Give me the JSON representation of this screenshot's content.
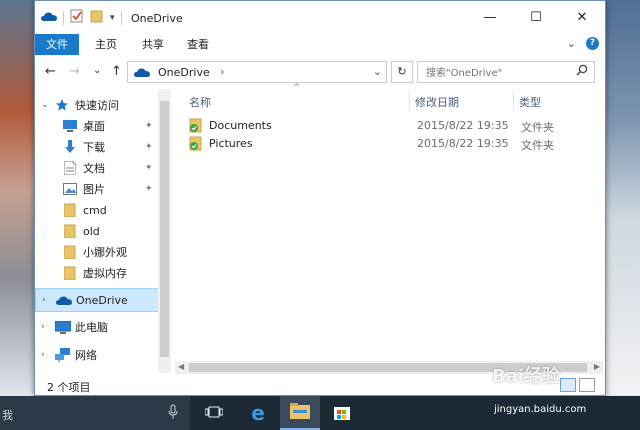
{
  "window": {
    "title": "OneDrive",
    "min_glyph": "—",
    "max_glyph": "☐",
    "close_glyph": "✕"
  },
  "ribbon": {
    "tabs": [
      {
        "label": "文件",
        "active": true
      },
      {
        "label": "主页",
        "active": false
      },
      {
        "label": "共享",
        "active": false
      },
      {
        "label": "查看",
        "active": false
      }
    ],
    "expand_glyph": "⌄",
    "help_glyph": "?"
  },
  "address": {
    "back_glyph": "←",
    "forward_glyph": "→",
    "recent_glyph": "⌄",
    "up_glyph": "↑",
    "path_label": "OneDrive",
    "sep_glyph": "›",
    "dropdown_glyph": "⌄",
    "refresh_glyph": "↻"
  },
  "search": {
    "placeholder": "搜索\"OneDrive\"",
    "icon": "search-icon"
  },
  "nav": {
    "items": [
      {
        "label": "快速访问",
        "icon": "star-icon",
        "pinned": false
      },
      {
        "label": "桌面",
        "icon": "desktop-icon",
        "pinned": true
      },
      {
        "label": "下载",
        "icon": "download-icon",
        "pinned": true
      },
      {
        "label": "文档",
        "icon": "document-icon",
        "pinned": true
      },
      {
        "label": "图片",
        "icon": "pictures-icon",
        "pinned": true
      },
      {
        "label": "cmd",
        "icon": "folder-icon",
        "pinned": false
      },
      {
        "label": "old",
        "icon": "folder-icon",
        "pinned": false
      },
      {
        "label": "小娜外观",
        "icon": "folder-icon",
        "pinned": false
      },
      {
        "label": "虚拟内存",
        "icon": "folder-icon",
        "pinned": false
      },
      {
        "label": "OneDrive",
        "icon": "onedrive-icon",
        "selected": true
      },
      {
        "label": "此电脑",
        "icon": "computer-icon"
      },
      {
        "label": "网络",
        "icon": "network-icon"
      }
    ],
    "expand_glyph": "›",
    "expanded_glyph": "⌄",
    "pin_glyph": "📌"
  },
  "list": {
    "sort_glyph": "^",
    "columns": [
      "名称",
      "修改日期",
      "类型"
    ],
    "rows": [
      {
        "name": "Documents",
        "date": "2015/8/22 19:35",
        "type": "文件夹"
      },
      {
        "name": "Pictures",
        "date": "2015/8/22 19:35",
        "type": "文件夹"
      }
    ]
  },
  "status": {
    "count": "2 个项目"
  },
  "taskbar": {
    "search_text": "我"
  },
  "watermark": {
    "logo": "Bai经验",
    "url": "jingyan.baidu.com"
  },
  "colors": {
    "accent": "#1979ca",
    "selected_bg": "#cce8ff",
    "folder": "#e8c46a",
    "sync_green": "#3ea53e",
    "onedrive_blue": "#0f5aa8"
  }
}
